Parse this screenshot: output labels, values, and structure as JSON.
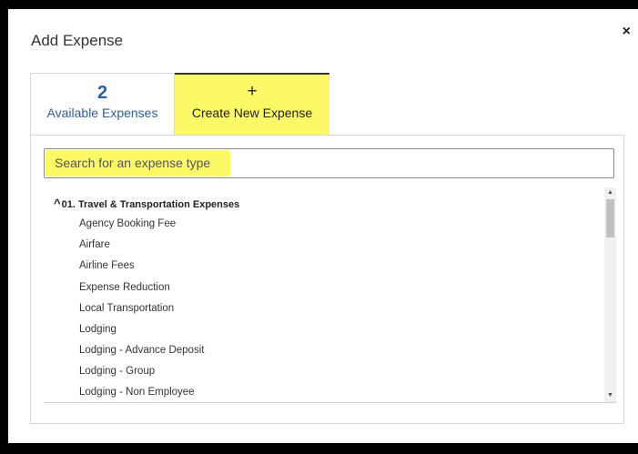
{
  "modal": {
    "title": "Add Expense",
    "close_icon": "close-icon",
    "close_glyph": "×"
  },
  "tabs": [
    {
      "count": "2",
      "label": "Available Expenses"
    },
    {
      "icon": "plus-icon",
      "glyph": "+",
      "label": "Create New Expense"
    }
  ],
  "search": {
    "placeholder": "Search for an expense type"
  },
  "group": {
    "caret": "^",
    "title": "01. Travel & Transportation Expenses",
    "items": [
      "Agency Booking Fee",
      "Airfare",
      "Airline Fees",
      "Expense Reduction",
      "Local Transportation",
      "Lodging",
      "Lodging - Advance Deposit",
      "Lodging - Group",
      "Lodging - Non Employee"
    ]
  },
  "scrollbar": {
    "up_glyph": "▲",
    "down_glyph": "▼"
  },
  "colors": {
    "highlight": "#fbfa66",
    "link": "#2f5e9a"
  }
}
